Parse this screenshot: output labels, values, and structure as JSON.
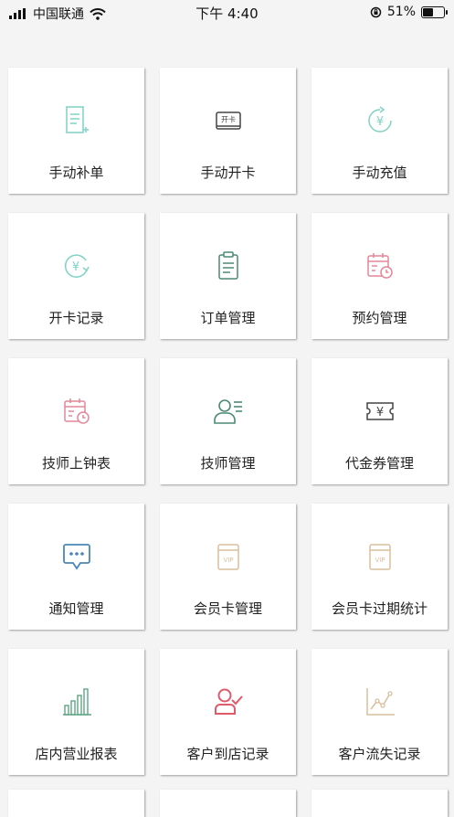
{
  "status": {
    "carrier": "中国联通",
    "time": "下午 4:40",
    "battery": "51%",
    "battery_level": 0.51
  },
  "menu": [
    {
      "label": "手动补单",
      "icon": "document-add-icon"
    },
    {
      "label": "手动开卡",
      "icon": "card-open-icon",
      "icon_text": "开卡"
    },
    {
      "label": "手动充值",
      "icon": "yen-recharge-icon",
      "icon_text": "¥"
    },
    {
      "label": "开卡记录",
      "icon": "yen-cycle-icon",
      "icon_text": "¥"
    },
    {
      "label": "订单管理",
      "icon": "clipboard-icon"
    },
    {
      "label": "预约管理",
      "icon": "calendar-clock-icon"
    },
    {
      "label": "技师上钟表",
      "icon": "calendar-clock-icon"
    },
    {
      "label": "技师管理",
      "icon": "user-list-icon"
    },
    {
      "label": "代金券管理",
      "icon": "voucher-icon",
      "icon_text": "¥"
    },
    {
      "label": "通知管理",
      "icon": "chat-bubble-icon"
    },
    {
      "label": "会员卡管理",
      "icon": "vip-card-icon",
      "icon_text": "VIP"
    },
    {
      "label": "会员卡过期统计",
      "icon": "vip-card-icon",
      "icon_text": "VIP"
    },
    {
      "label": "店内营业报表",
      "icon": "bar-chart-icon"
    },
    {
      "label": "客户到店记录",
      "icon": "user-check-icon"
    },
    {
      "label": "客户流失记录",
      "icon": "line-chart-icon"
    }
  ],
  "colors": {
    "teal": "#7fd3c4",
    "dark_gray": "#444444",
    "green_gray": "#4a8a74",
    "pink": "#e3879a",
    "blue": "#4a86b8",
    "beige": "#d9bf9c",
    "red": "#e05a6a",
    "green": "#5fa583"
  }
}
